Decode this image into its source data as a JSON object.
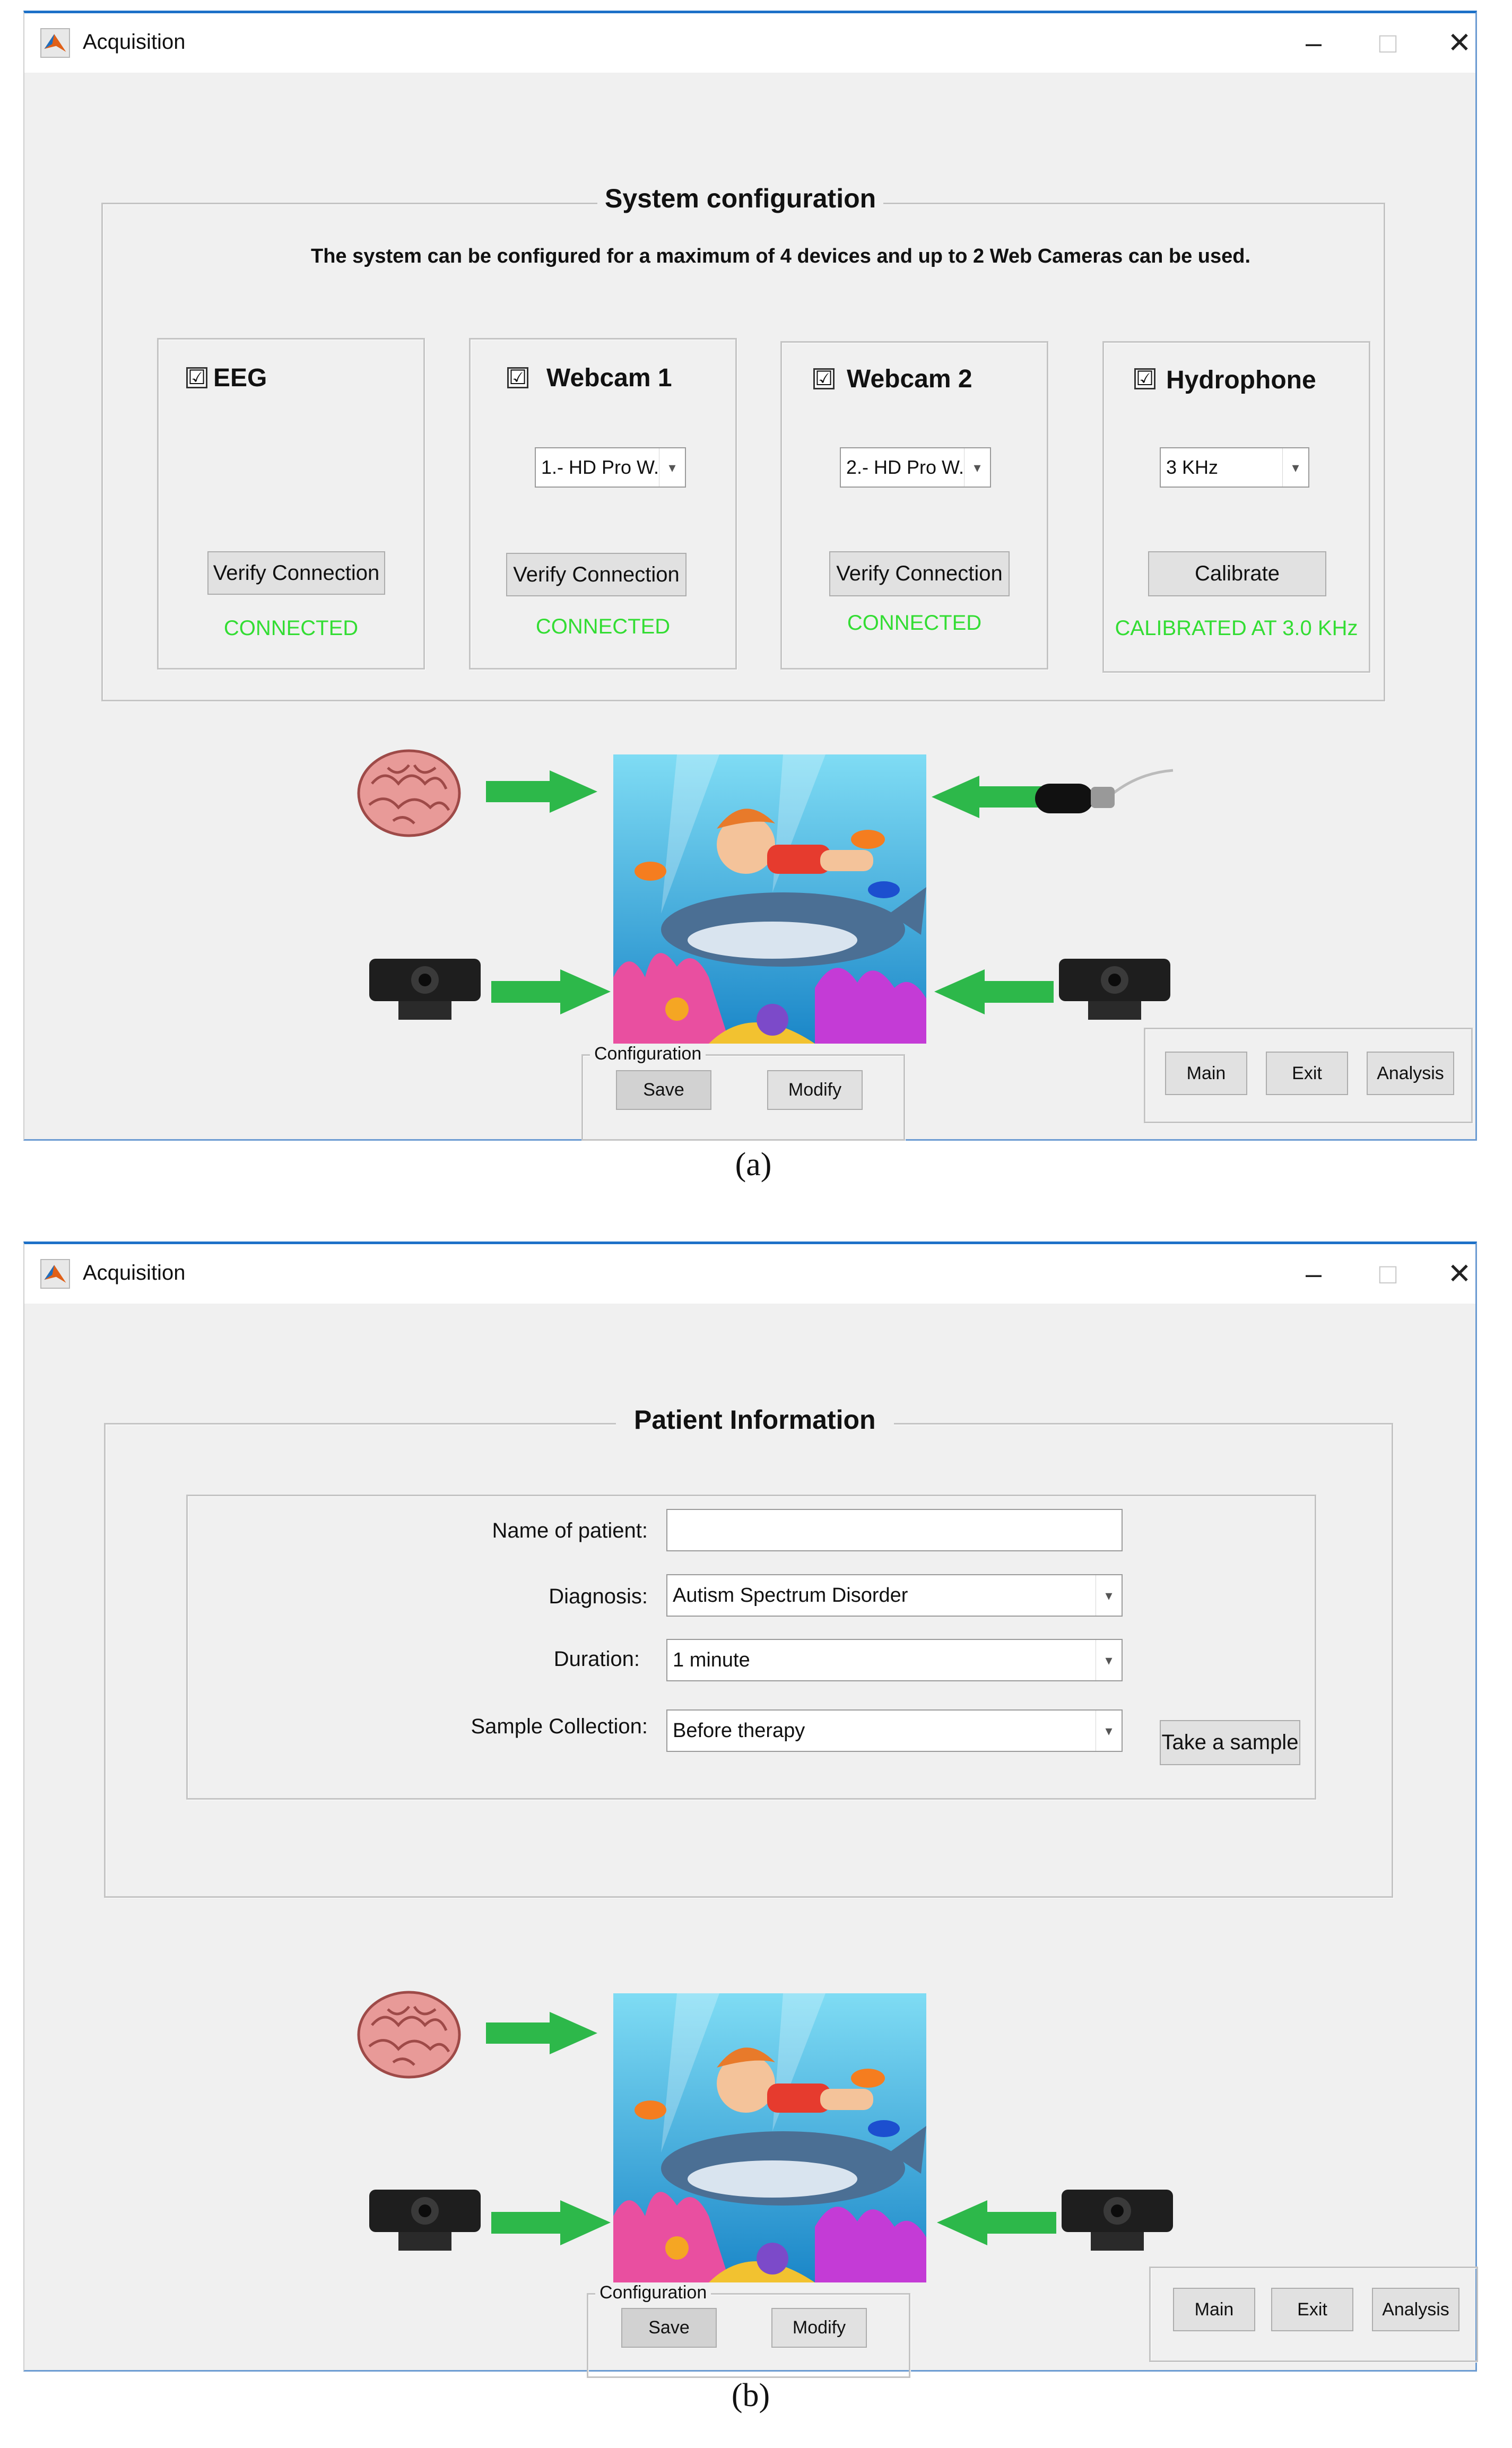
{
  "window_title": "Acquisition",
  "window_controls": {
    "minimize": "–",
    "maximize": "□",
    "close": "✕"
  },
  "panel_a": {
    "section_title": "System configuration",
    "description": "The system can be configured for a maximum of 4 devices and up to 2 Web Cameras can be used.",
    "devices": [
      {
        "label": "EEG",
        "checked": "☑",
        "button": "Verify Connection",
        "status": "CONNECTED"
      },
      {
        "label": "Webcam 1",
        "checked": "☑",
        "dropdown": "1.- HD Pro W...",
        "button": "Verify Connection",
        "status": "CONNECTED"
      },
      {
        "label": "Webcam 2",
        "checked": "☑",
        "dropdown": "2.- HD Pro W...",
        "button": "Verify Connection",
        "status": "CONNECTED"
      },
      {
        "label": "Hydrophone",
        "checked": "☑",
        "dropdown": "3 KHz",
        "button": "Calibrate",
        "status": "CALIBRATED AT  3.0 KHz"
      }
    ],
    "config_group": {
      "title": "Configuration",
      "save": "Save",
      "modify": "Modify"
    },
    "nav": {
      "main": "Main",
      "exit": "Exit",
      "analysis": "Analysis"
    },
    "caption": "(a)"
  },
  "panel_b": {
    "section_title": "Patient Information",
    "fields": {
      "name_label": "Name of patient:",
      "name_value": "",
      "diagnosis_label": "Diagnosis:",
      "diagnosis_value": "Autism Spectrum Disorder",
      "duration_label": "Duration:",
      "duration_value": "1 minute",
      "sample_label": "Sample Collection:",
      "sample_value": "Before therapy",
      "take_sample": "Take a sample"
    },
    "config_group": {
      "title": "Configuration",
      "save": "Save",
      "modify": "Modify"
    },
    "nav": {
      "main": "Main",
      "exit": "Exit",
      "analysis": "Analysis"
    },
    "caption": "(b)"
  },
  "colors": {
    "status_green": "#33dd33",
    "arrow_green": "#2db84a",
    "titlebar_blue": "#1d71c8"
  },
  "icons": {
    "dropdown": "▾"
  }
}
